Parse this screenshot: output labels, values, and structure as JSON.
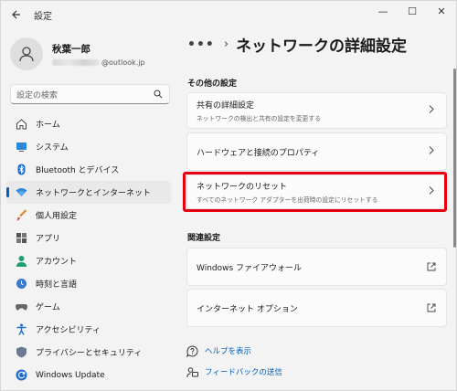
{
  "window": {
    "title": "設定",
    "controls": {
      "minimize": "—",
      "maximize": "☐",
      "close": "✕"
    }
  },
  "profile": {
    "name": "秋葉一郎",
    "email_suffix": "@outlook.jp"
  },
  "search": {
    "placeholder": "設定の検索"
  },
  "nav": {
    "items": [
      {
        "label": "ホーム",
        "icon": "home-icon"
      },
      {
        "label": "システム",
        "icon": "system-icon"
      },
      {
        "label": "Bluetooth とデバイス",
        "icon": "bluetooth-icon"
      },
      {
        "label": "ネットワークとインターネット",
        "icon": "network-icon",
        "active": true
      },
      {
        "label": "個人用設定",
        "icon": "brush-icon"
      },
      {
        "label": "アプリ",
        "icon": "apps-icon"
      },
      {
        "label": "アカウント",
        "icon": "account-icon"
      },
      {
        "label": "時刻と言語",
        "icon": "time-language-icon"
      },
      {
        "label": "ゲーム",
        "icon": "gaming-icon"
      },
      {
        "label": "アクセシビリティ",
        "icon": "accessibility-icon"
      },
      {
        "label": "プライバシーとセキュリティ",
        "icon": "shield-icon"
      },
      {
        "label": "Windows Update",
        "icon": "windows-update-icon"
      }
    ]
  },
  "breadcrumb": {
    "more": "•••",
    "separator": "›",
    "title": "ネットワークの詳細設定"
  },
  "sections": {
    "other": {
      "label": "その他の設定",
      "cards": [
        {
          "title": "共有の詳細設定",
          "subtitle": "ネットワークの検出と共有の設定を変更する"
        },
        {
          "title": "ハードウェアと接続のプロパティ",
          "subtitle": ""
        },
        {
          "title": "ネットワークのリセット",
          "subtitle": "すべてのネットワーク アダプターを出荷時の設定にリセットする"
        }
      ]
    },
    "related": {
      "label": "関連設定",
      "cards": [
        {
          "title": "Windows ファイアウォール"
        },
        {
          "title": "インターネット オプション"
        }
      ]
    }
  },
  "help": {
    "get_help": "ヘルプを表示",
    "feedback": "フィードバックの送信"
  },
  "colors": {
    "accent": "#005fb8",
    "highlight": "#e60012"
  }
}
